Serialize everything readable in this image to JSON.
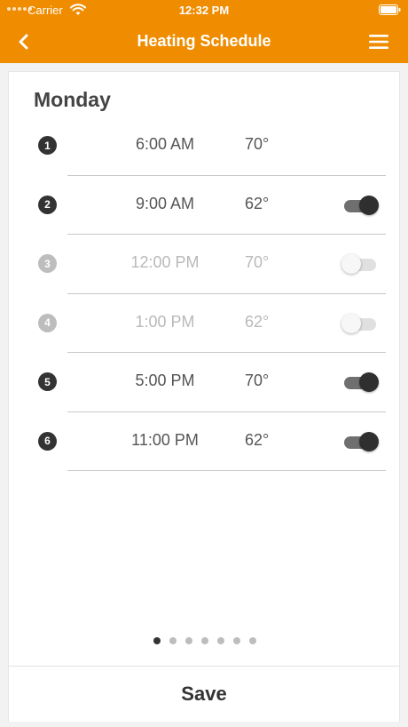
{
  "status_bar": {
    "carrier": "Carrier",
    "time": "12:32 PM"
  },
  "nav": {
    "title": "Heating Schedule",
    "back_icon": "chevron-left-icon",
    "menu_icon": "hamburger-menu-icon"
  },
  "colors": {
    "accent": "#ef8c00",
    "active_dark": "#333333",
    "inactive": "#bdbdbd"
  },
  "schedule": {
    "day": "Monday",
    "rows": [
      {
        "number": "1",
        "time": "6:00 AM",
        "temp": "70°",
        "toggle": null
      },
      {
        "number": "2",
        "time": "9:00 AM",
        "temp": "62°",
        "toggle": "on"
      },
      {
        "number": "3",
        "time": "12:00 PM",
        "temp": "70°",
        "toggle": "off"
      },
      {
        "number": "4",
        "time": "1:00 PM",
        "temp": "62°",
        "toggle": "off"
      },
      {
        "number": "5",
        "time": "5:00 PM",
        "temp": "70°",
        "toggle": "on"
      },
      {
        "number": "6",
        "time": "11:00 PM",
        "temp": "62°",
        "toggle": "on"
      }
    ]
  },
  "pagination": {
    "total": 7,
    "current": 1
  },
  "footer": {
    "save_label": "Save"
  }
}
